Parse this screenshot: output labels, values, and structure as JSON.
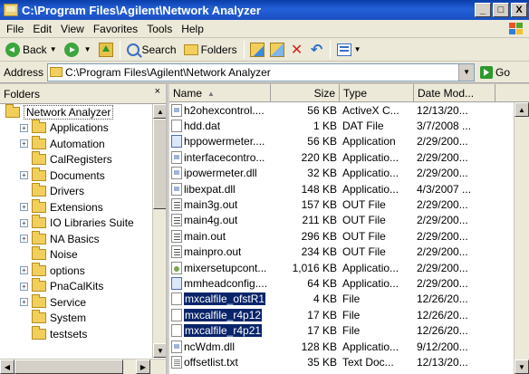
{
  "window": {
    "title": "C:\\Program Files\\Agilent\\Network Analyzer",
    "minimize": "_",
    "maximize": "□",
    "close": "X"
  },
  "menu": [
    "File",
    "Edit",
    "View",
    "Favorites",
    "Tools",
    "Help"
  ],
  "toolbar": {
    "back_label": "Back",
    "search_label": "Search",
    "folders_label": "Folders"
  },
  "address": {
    "label": "Address",
    "value": "C:\\Program Files\\Agilent\\Network Analyzer",
    "go_label": "Go"
  },
  "folders": {
    "header": "Folders",
    "close": "×",
    "root": "Network Analyzer",
    "items": [
      {
        "label": "Applications",
        "expandable": true
      },
      {
        "label": "Automation",
        "expandable": true
      },
      {
        "label": "CalRegisters",
        "expandable": false
      },
      {
        "label": "Documents",
        "expandable": true
      },
      {
        "label": "Drivers",
        "expandable": false
      },
      {
        "label": "Extensions",
        "expandable": true
      },
      {
        "label": "IO Libraries Suite",
        "expandable": true
      },
      {
        "label": "NA Basics",
        "expandable": true
      },
      {
        "label": "Noise",
        "expandable": false
      },
      {
        "label": "options",
        "expandable": true
      },
      {
        "label": "PnaCalKits",
        "expandable": true
      },
      {
        "label": "Service",
        "expandable": true
      },
      {
        "label": "System",
        "expandable": false
      },
      {
        "label": "testsets",
        "expandable": false
      }
    ]
  },
  "files": {
    "columns": {
      "name": "Name",
      "size": "Size",
      "type": "Type",
      "date": "Date Mod..."
    },
    "rows": [
      {
        "name": "h2ohexcontrol....",
        "size": "56 KB",
        "type": "ActiveX C...",
        "date": "12/13/20...",
        "icon": "dll",
        "selected": false
      },
      {
        "name": "hdd.dat",
        "size": "1 KB",
        "type": "DAT File",
        "date": "3/7/2008 ...",
        "icon": "file",
        "selected": false
      },
      {
        "name": "hppowermeter....",
        "size": "56 KB",
        "type": "Application",
        "date": "2/29/200...",
        "icon": "exe",
        "selected": false
      },
      {
        "name": "interfacecontro...",
        "size": "220 KB",
        "type": "Applicatio...",
        "date": "2/29/200...",
        "icon": "dll",
        "selected": false
      },
      {
        "name": "ipowermeter.dll",
        "size": "32 KB",
        "type": "Applicatio...",
        "date": "2/29/200...",
        "icon": "dll",
        "selected": false
      },
      {
        "name": "libexpat.dll",
        "size": "148 KB",
        "type": "Applicatio...",
        "date": "4/3/2007 ...",
        "icon": "dll",
        "selected": false
      },
      {
        "name": "main3g.out",
        "size": "157 KB",
        "type": "OUT File",
        "date": "2/29/200...",
        "icon": "out",
        "selected": false
      },
      {
        "name": "main4g.out",
        "size": "211 KB",
        "type": "OUT File",
        "date": "2/29/200...",
        "icon": "out",
        "selected": false
      },
      {
        "name": "main.out",
        "size": "296 KB",
        "type": "OUT File",
        "date": "2/29/200...",
        "icon": "out",
        "selected": false
      },
      {
        "name": "mainpro.out",
        "size": "234 KB",
        "type": "OUT File",
        "date": "2/29/200...",
        "icon": "out",
        "selected": false
      },
      {
        "name": "mixersetupcont...",
        "size": "1,016 KB",
        "type": "Applicatio...",
        "date": "2/29/200...",
        "icon": "cfg",
        "selected": false
      },
      {
        "name": "mmheadconfig....",
        "size": "64 KB",
        "type": "Applicatio...",
        "date": "2/29/200...",
        "icon": "exe",
        "selected": false
      },
      {
        "name": "mxcalfile_ofstR1",
        "size": "4 KB",
        "type": "File",
        "date": "12/26/20...",
        "icon": "file",
        "selected": true
      },
      {
        "name": "mxcalfile_r4p12",
        "size": "17 KB",
        "type": "File",
        "date": "12/26/20...",
        "icon": "file",
        "selected": true
      },
      {
        "name": "mxcalfile_r4p21",
        "size": "17 KB",
        "type": "File",
        "date": "12/26/20...",
        "icon": "file",
        "selected": true
      },
      {
        "name": "ncWdm.dll",
        "size": "128 KB",
        "type": "Applicatio...",
        "date": "9/12/200...",
        "icon": "dll",
        "selected": false
      },
      {
        "name": "offsetlist.txt",
        "size": "35 KB",
        "type": "Text Doc...",
        "date": "12/13/20...",
        "icon": "txt",
        "selected": false
      }
    ]
  }
}
